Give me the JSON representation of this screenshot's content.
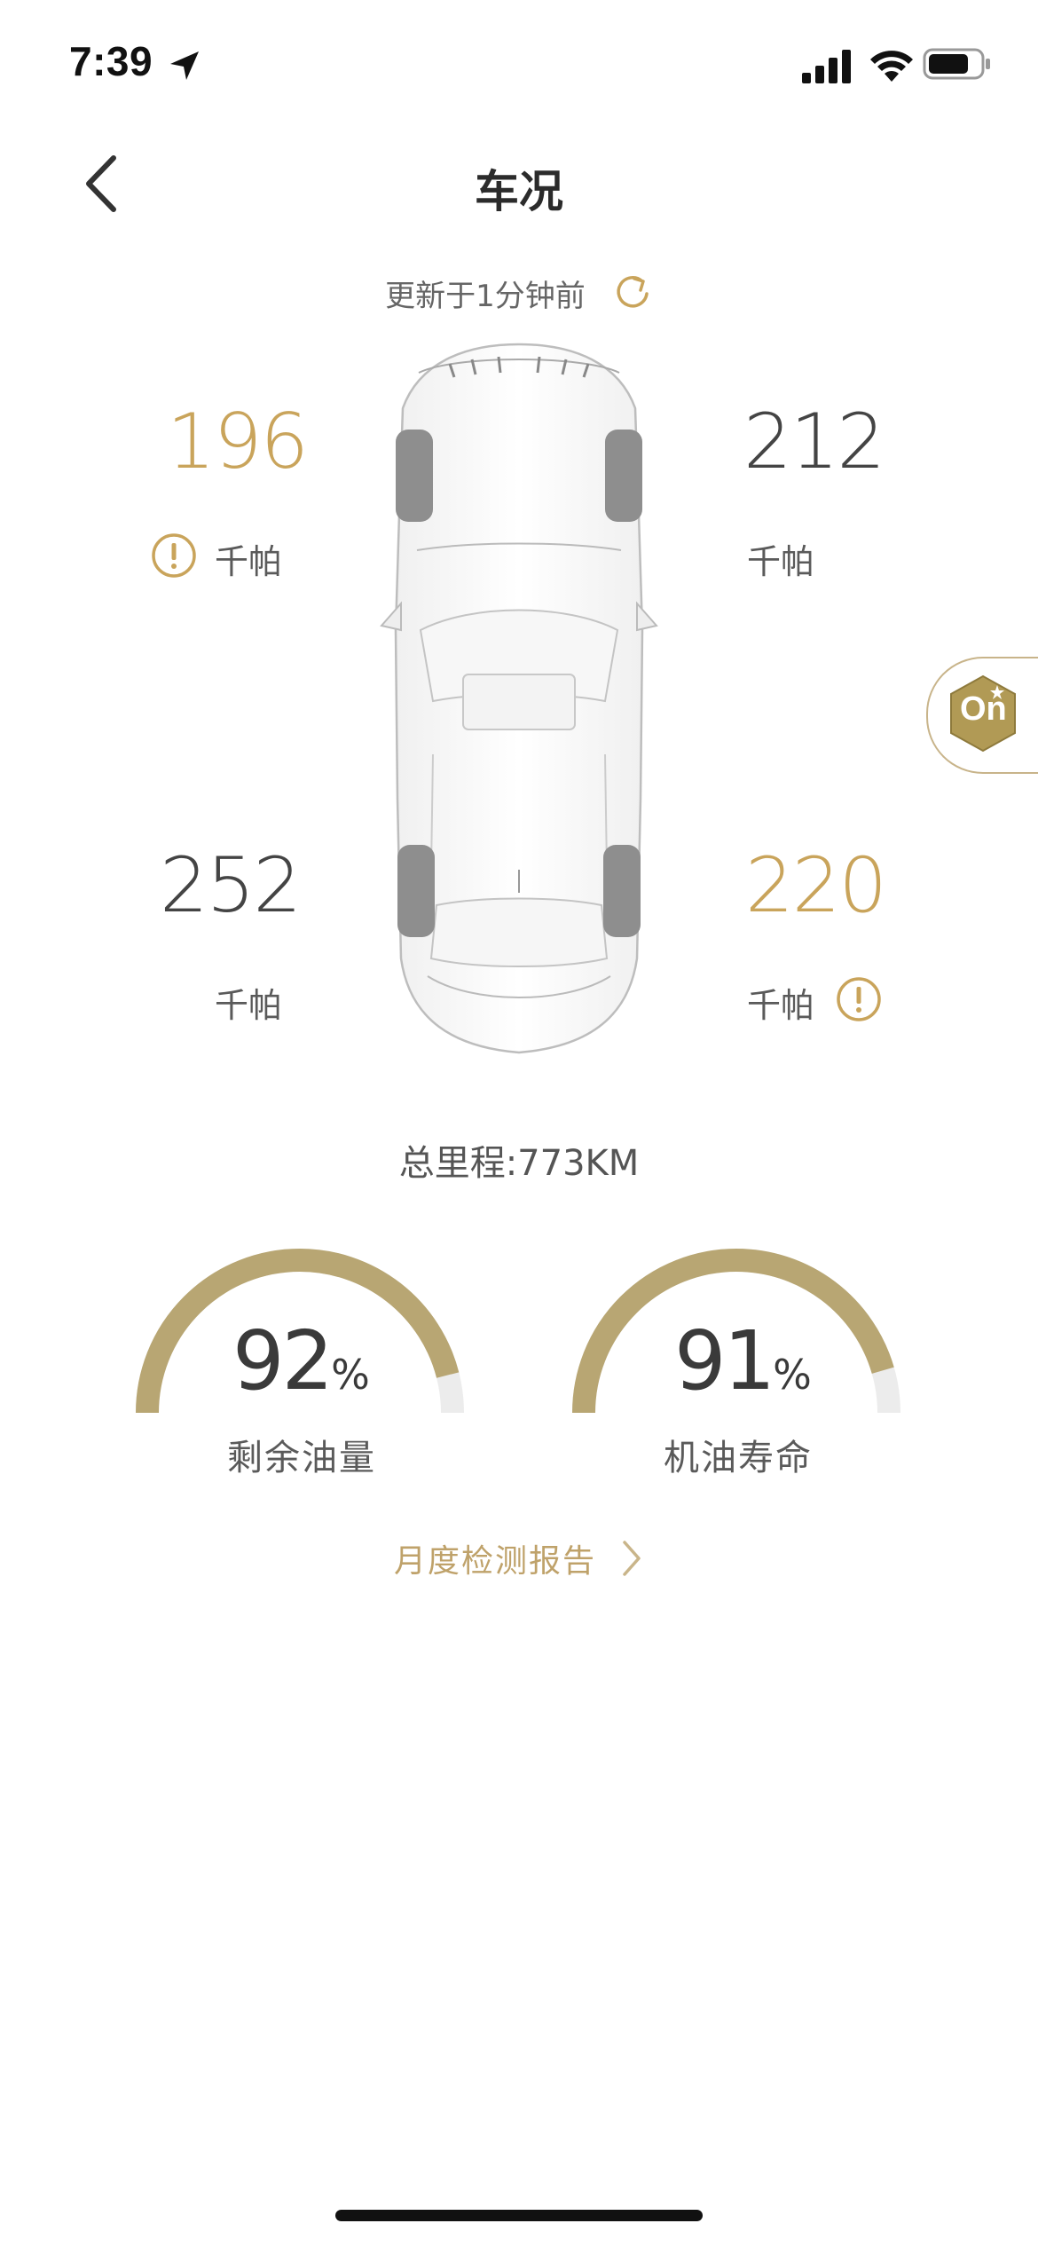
{
  "status_bar": {
    "time": "7:39"
  },
  "nav": {
    "title": "车况"
  },
  "update": {
    "text": "更新于1分钟前"
  },
  "tires": {
    "front_left": {
      "value": "196",
      "unit": "千帕",
      "warning": true
    },
    "front_right": {
      "value": "212",
      "unit": "千帕",
      "warning": false
    },
    "rear_left": {
      "value": "252",
      "unit": "千帕",
      "warning": false
    },
    "rear_right": {
      "value": "220",
      "unit": "千帕",
      "warning": true
    }
  },
  "mileage": {
    "text": "总里程:773KM"
  },
  "gauges": {
    "fuel": {
      "value": "92",
      "percent": 92,
      "unit": "%",
      "label": "剩余油量"
    },
    "oil": {
      "value": "91",
      "percent": 91,
      "unit": "%",
      "label": "机油寿命"
    }
  },
  "report": {
    "label": "月度检测报告"
  },
  "badge": {
    "text": "On"
  },
  "colors": {
    "gold": "#c9a45b",
    "gauge_fill": "#b8a673",
    "gauge_track": "#ececec",
    "dark_text": "#444444"
  }
}
